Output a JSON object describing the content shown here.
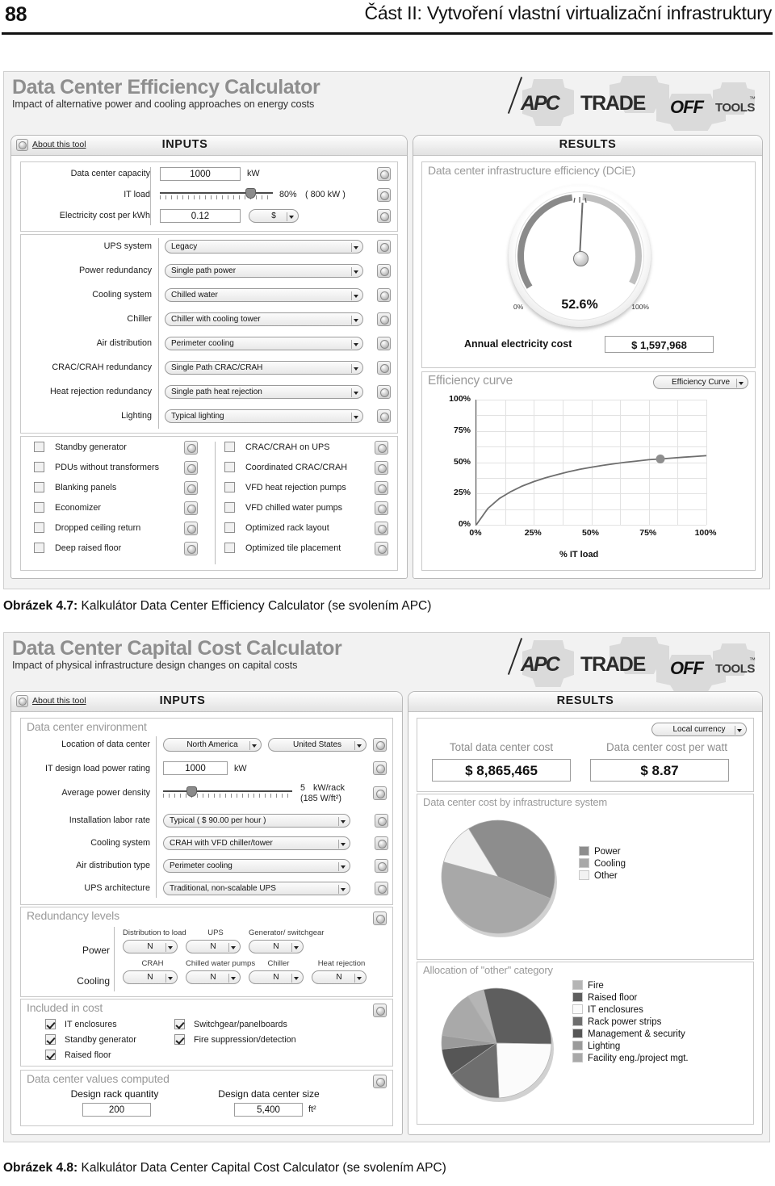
{
  "page": {
    "number": "88",
    "running_head": "Část II: Vytvoření vlastní virtualizační infrastruktury"
  },
  "captions": {
    "fig47_bold": "Obrázek 4.7:",
    "fig47_text": " Kalkulátor Data Center Efficiency Calculator (se svolením APC)",
    "fig48_bold": "Obrázek 4.8:",
    "fig48_text": " Kalkulátor Data Center Capital Cost Calculator (se svolením APC)"
  },
  "logo": {
    "apc": "APC",
    "trade": "TRADE",
    "off": "OFF",
    "tools": "TOOLS",
    "tm": "™"
  },
  "efficiency_tool": {
    "title": "Data Center Efficiency Calculator",
    "subtitle": "Impact of alternative power and cooling approaches on energy costs",
    "about_label": "About this tool",
    "inputs_title": "INPUTS",
    "results_title": "RESULTS",
    "basic_inputs": [
      {
        "label": "Data center capacity",
        "value": "1000",
        "unit": "kW"
      },
      {
        "label": "IT load",
        "value": "80%",
        "extra": "( 800 kW )",
        "slider_pct": 80
      },
      {
        "label": "Electricity cost per kWh",
        "value": "0.12",
        "currency": "$"
      }
    ],
    "dropdowns": [
      {
        "label": "UPS system",
        "value": "Legacy"
      },
      {
        "label": "Power redundancy",
        "value": "Single path power"
      },
      {
        "label": "Cooling system",
        "value": "Chilled water"
      },
      {
        "label": "Chiller",
        "value": "Chiller with cooling tower"
      },
      {
        "label": "Air distribution",
        "value": "Perimeter cooling"
      },
      {
        "label": "CRAC/CRAH redundancy",
        "value": "Single Path CRAC/CRAH"
      },
      {
        "label": "Heat rejection redundancy",
        "value": "Single path heat rejection"
      },
      {
        "label": "Lighting",
        "value": "Typical lighting"
      }
    ],
    "checkboxes_left": [
      {
        "label": "Standby generator",
        "checked": false
      },
      {
        "label": "PDUs without transformers",
        "checked": false
      },
      {
        "label": "Blanking panels",
        "checked": false
      },
      {
        "label": "Economizer",
        "checked": false
      },
      {
        "label": "Dropped ceiling return",
        "checked": false
      },
      {
        "label": "Deep raised floor",
        "checked": false
      }
    ],
    "checkboxes_right": [
      {
        "label": "CRAC/CRAH on UPS",
        "checked": false
      },
      {
        "label": "Coordinated CRAC/CRAH",
        "checked": false
      },
      {
        "label": "VFD heat rejection pumps",
        "checked": false
      },
      {
        "label": "VFD chilled water pumps",
        "checked": false
      },
      {
        "label": "Optimized rack layout",
        "checked": false
      },
      {
        "label": "Optimized tile placement",
        "checked": false
      }
    ],
    "dcie": {
      "panel_title": "Data center infrastructure efficiency (DCiE)",
      "value": "52.6%",
      "min_label": "0%",
      "max_label": "100%"
    },
    "annual_cost": {
      "label": "Annual electricity cost",
      "value": "$ 1,597,968"
    },
    "efficiency_curve": {
      "panel_title": "Efficiency curve",
      "selector_value": "Efficiency Curve"
    }
  },
  "capital_tool": {
    "title": "Data Center Capital Cost Calculator",
    "subtitle": "Impact of physical infrastructure design changes on capital costs",
    "about_label": "About this tool",
    "inputs_title": "INPUTS",
    "results_title": "RESULTS",
    "environment": {
      "group_title": "Data center environment",
      "location_label": "Location of data center",
      "location_region": "North America",
      "location_country": "United States",
      "load_label": "IT design load power rating",
      "load_value": "1000",
      "load_unit": "kW",
      "density_label": "Average power density",
      "density_value": "5",
      "density_unit": "kW/rack",
      "density_sub": "(185 W/ft²)",
      "density_slider_pct": 22,
      "dropdowns": [
        {
          "label": "Installation labor rate",
          "value": "Typical ( $ 90.00 per hour )"
        },
        {
          "label": "Cooling system",
          "value": "CRAH with VFD chiller/tower"
        },
        {
          "label": "Air distribution type",
          "value": "Perimeter cooling"
        },
        {
          "label": "UPS architecture",
          "value": "Traditional, non-scalable UPS"
        }
      ]
    },
    "redundancy": {
      "group_title": "Redundancy levels",
      "power_label": "Power",
      "cooling_label": "Cooling",
      "power_items": [
        {
          "header": "Distribution to load",
          "value": "N"
        },
        {
          "header": "UPS",
          "value": "N"
        },
        {
          "header": "Generator/ switchgear",
          "value": "N"
        }
      ],
      "cooling_items": [
        {
          "header": "CRAH",
          "value": "N"
        },
        {
          "header": "Chilled water pumps",
          "value": "N"
        },
        {
          "header": "Chiller",
          "value": "N"
        },
        {
          "header": "Heat rejection",
          "value": "N"
        }
      ]
    },
    "included": {
      "group_title": "Included in cost",
      "left": [
        {
          "label": "IT enclosures",
          "checked": true
        },
        {
          "label": "Standby generator",
          "checked": true
        },
        {
          "label": "Raised floor",
          "checked": true
        }
      ],
      "right": [
        {
          "label": "Switchgear/panelboards",
          "checked": true
        },
        {
          "label": "Fire suppression/detection",
          "checked": true
        }
      ]
    },
    "computed": {
      "group_title": "Data center values computed",
      "rack_label": "Design rack quantity",
      "rack_value": "200",
      "size_label": "Design data center size",
      "size_value": "5,400",
      "size_unit": "ft²"
    },
    "results": {
      "currency_selector": "Local currency",
      "total_label": "Total data center cost",
      "total_value": "$ 8,865,465",
      "perwatt_label": "Data center cost per watt",
      "perwatt_value": "$ 8.87"
    }
  },
  "chart_data": [
    {
      "type": "line",
      "title": "Efficiency curve",
      "xlabel": "% IT load",
      "ylabel": "",
      "xticks": [
        "0%",
        "25%",
        "50%",
        "75%",
        "100%"
      ],
      "yticks": [
        "0%",
        "25%",
        "50%",
        "75%",
        "100%"
      ],
      "xlim": [
        0,
        100
      ],
      "ylim": [
        0,
        100
      ],
      "grid": true,
      "series": [
        {
          "name": "Efficiency Curve",
          "x": [
            0,
            5,
            10,
            15,
            20,
            25,
            30,
            35,
            40,
            45,
            50,
            55,
            60,
            65,
            70,
            75,
            80,
            85,
            90,
            95,
            100
          ],
          "y": [
            0,
            13,
            21,
            26.5,
            31,
            34.5,
            37.5,
            40,
            42.3,
            44.3,
            46,
            47.5,
            48.8,
            50,
            51,
            52,
            52.6,
            53.3,
            54,
            54.6,
            55.2
          ]
        }
      ],
      "marker": {
        "x": 80,
        "y": 52.6
      }
    },
    {
      "type": "gauge",
      "title": "Data center infrastructure efficiency (DCiE)",
      "value": 52.6,
      "unit": "%",
      "min": 0,
      "max": 100,
      "min_label": "0%",
      "max_label": "100%"
    },
    {
      "type": "pie",
      "title": "Data center cost by infrastructure system",
      "labels": [
        "Power",
        "Cooling",
        "Other"
      ],
      "values": [
        40,
        48,
        12
      ],
      "colors": [
        "#8d8d8d",
        "#a8a8a8",
        "#f2f2f2"
      ],
      "legend_position": "right"
    },
    {
      "type": "pie",
      "title": "Allocation of \"other\" category",
      "labels": [
        "Fire",
        "Raised floor",
        "IT enclosures",
        "Rack power strips",
        "Management & security",
        "Lighting",
        "Facility eng./project mgt."
      ],
      "values": [
        5,
        29,
        24,
        16,
        8,
        4,
        14
      ],
      "colors": [
        "#b5b5b5",
        "#5e5e5e",
        "#fbfbfb",
        "#6e6e6e",
        "#565656",
        "#9a9a9a",
        "#a9a9a9"
      ],
      "legend_position": "right"
    }
  ]
}
